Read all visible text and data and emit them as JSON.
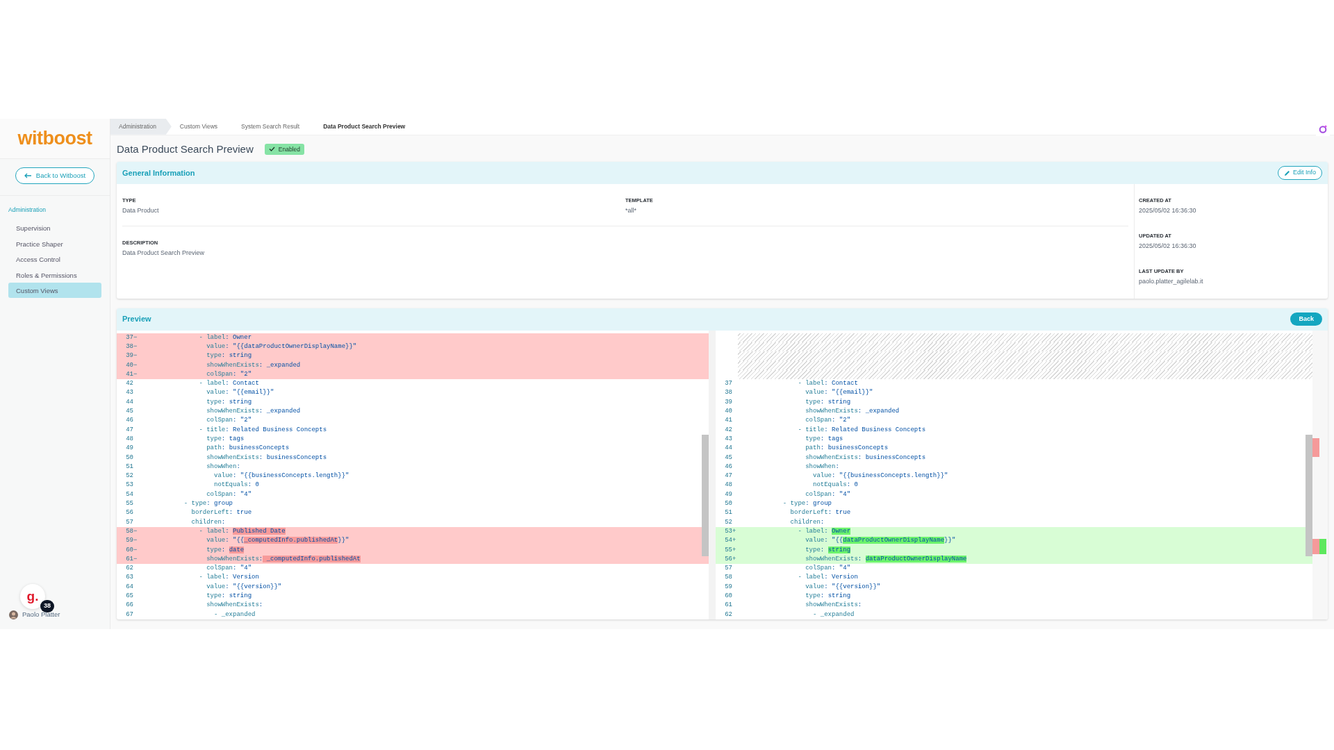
{
  "logo": "witboost",
  "back_link": "Back to Witboost",
  "sidebar": {
    "section": "Administration",
    "items": [
      {
        "label": "Supervision",
        "selected": false
      },
      {
        "label": "Practice Shaper",
        "selected": false
      },
      {
        "label": "Access Control",
        "selected": false
      },
      {
        "label": "Roles & Permissions",
        "selected": false
      },
      {
        "label": "Custom Views",
        "selected": true
      }
    ]
  },
  "assistant": {
    "glyph": "g.",
    "count": "38"
  },
  "user": {
    "name": "Paolo Platter"
  },
  "breadcrumbs": [
    {
      "label": "Administration",
      "hovered": true,
      "selected": false
    },
    {
      "label": "Custom Views",
      "hovered": false,
      "selected": false
    },
    {
      "label": "System Search Result",
      "hovered": false,
      "selected": false
    },
    {
      "label": "Data Product Search Preview",
      "hovered": false,
      "selected": true
    }
  ],
  "page": {
    "title": "Data Product Search Preview",
    "status": "Enabled"
  },
  "general_info": {
    "title": "General Information",
    "edit_button": "Edit Info",
    "rows": [
      [
        {
          "label": "TYPE",
          "value": "Data Product"
        },
        {
          "label": "TEMPLATE",
          "value": "*all*"
        }
      ],
      [
        {
          "label": "DESCRIPTION",
          "value": "Data Product Search Preview"
        }
      ]
    ],
    "meta": [
      {
        "label": "CREATED AT",
        "value": "2025/05/02 16:36:30"
      },
      {
        "label": "UPDATED AT",
        "value": "2025/05/02 16:36:30"
      },
      {
        "label": "LAST UPDATE BY",
        "value": "paolo.platter_agilelab.it"
      }
    ]
  },
  "preview": {
    "title": "Preview",
    "back_button": "Back",
    "left": [
      {
        "kind": "removed",
        "number": "37",
        "marker": "−",
        "text": "                - label: Owner"
      },
      {
        "kind": "removed",
        "number": "38",
        "marker": "−",
        "text": "                  value: \"{{dataProductOwnerDisplayName}}\""
      },
      {
        "kind": "removed",
        "number": "39",
        "marker": "−",
        "text": "                  type: string"
      },
      {
        "kind": "removed",
        "number": "40",
        "marker": "−",
        "text": "                  showWhenExists: _expanded"
      },
      {
        "kind": "removed",
        "number": "41",
        "marker": "−",
        "text": "                  colSpan: \"2\""
      },
      {
        "kind": "context",
        "number": "42",
        "text": "                - label: Contact"
      },
      {
        "kind": "context",
        "number": "43",
        "text": "                  value: \"{{email}}\""
      },
      {
        "kind": "context",
        "number": "44",
        "text": "                  type: string"
      },
      {
        "kind": "context",
        "number": "45",
        "text": "                  showWhenExists: _expanded"
      },
      {
        "kind": "context",
        "number": "46",
        "text": "                  colSpan: \"2\""
      },
      {
        "kind": "context",
        "number": "47",
        "text": "                - title: Related Business Concepts"
      },
      {
        "kind": "context",
        "number": "48",
        "text": "                  type: tags"
      },
      {
        "kind": "context",
        "number": "49",
        "text": "                  path: businessConcepts"
      },
      {
        "kind": "context",
        "number": "50",
        "text": "                  showWhenExists: businessConcepts"
      },
      {
        "kind": "context",
        "number": "51",
        "text": "                  showWhen:"
      },
      {
        "kind": "context",
        "number": "52",
        "text": "                    value: \"{{businessConcepts.length}}\""
      },
      {
        "kind": "context",
        "number": "53",
        "text": "                    notEquals: 0"
      },
      {
        "kind": "context",
        "number": "54",
        "text": "                  colSpan: \"4\""
      },
      {
        "kind": "context",
        "number": "55",
        "text": "            - type: group"
      },
      {
        "kind": "context",
        "number": "56",
        "text": "              borderLeft: true"
      },
      {
        "kind": "context",
        "number": "57",
        "text": "              children:"
      },
      {
        "kind": "removed",
        "number": "58",
        "marker": "−",
        "segments": [
          {
            "text": "                - label: ",
            "changed": false
          },
          {
            "text": "Published Date",
            "changed": true
          }
        ]
      },
      {
        "kind": "removed",
        "number": "59",
        "marker": "−",
        "segments": [
          {
            "text": "                  value: \"{{",
            "changed": false
          },
          {
            "text": "_computedInfo.publishedAt",
            "changed": true
          },
          {
            "text": "}}\"",
            "changed": false
          }
        ]
      },
      {
        "kind": "removed",
        "number": "60",
        "marker": "−",
        "segments": [
          {
            "text": "                  type: ",
            "changed": false
          },
          {
            "text": "date",
            "changed": true
          }
        ]
      },
      {
        "kind": "removed",
        "number": "61",
        "marker": "−",
        "segments": [
          {
            "text": "                  showWhenExists:",
            "changed": false
          },
          {
            "text": " _computedInfo.publishedAt",
            "changed": true
          }
        ]
      },
      {
        "kind": "context",
        "number": "62",
        "text": "                  colSpan: \"4\""
      },
      {
        "kind": "context",
        "number": "63",
        "text": "                - label: Version"
      },
      {
        "kind": "context",
        "number": "64",
        "text": "                  value: \"{{version}}\""
      },
      {
        "kind": "context",
        "number": "65",
        "text": "                  type: string"
      },
      {
        "kind": "context",
        "number": "66",
        "text": "                  showWhenExists:"
      },
      {
        "kind": "context",
        "number": "67",
        "text": "                    - _expanded"
      }
    ],
    "right": [
      {
        "kind": "filler"
      },
      {
        "kind": "filler"
      },
      {
        "kind": "filler"
      },
      {
        "kind": "filler"
      },
      {
        "kind": "filler"
      },
      {
        "kind": "context",
        "number": "37",
        "text": "                - label: Contact"
      },
      {
        "kind": "context",
        "number": "38",
        "text": "                  value: \"{{email}}\""
      },
      {
        "kind": "context",
        "number": "39",
        "text": "                  type: string"
      },
      {
        "kind": "context",
        "number": "40",
        "text": "                  showWhenExists: _expanded"
      },
      {
        "kind": "context",
        "number": "41",
        "text": "                  colSpan: \"2\""
      },
      {
        "kind": "context",
        "number": "42",
        "text": "                - title: Related Business Concepts"
      },
      {
        "kind": "context",
        "number": "43",
        "text": "                  type: tags"
      },
      {
        "kind": "context",
        "number": "44",
        "text": "                  path: businessConcepts"
      },
      {
        "kind": "context",
        "number": "45",
        "text": "                  showWhenExists: businessConcepts"
      },
      {
        "kind": "context",
        "number": "46",
        "text": "                  showWhen:"
      },
      {
        "kind": "context",
        "number": "47",
        "text": "                    value: \"{{businessConcepts.length}}\""
      },
      {
        "kind": "context",
        "number": "48",
        "text": "                    notEquals: 0"
      },
      {
        "kind": "context",
        "number": "49",
        "text": "                  colSpan: \"4\""
      },
      {
        "kind": "context",
        "number": "50",
        "text": "            - type: group"
      },
      {
        "kind": "context",
        "number": "51",
        "text": "              borderLeft: true"
      },
      {
        "kind": "context",
        "number": "52",
        "text": "              children:"
      },
      {
        "kind": "added",
        "number": "53",
        "marker": "+",
        "segments": [
          {
            "text": "                - label: ",
            "changed": false
          },
          {
            "text": "Owner",
            "changed": true
          }
        ]
      },
      {
        "kind": "added",
        "number": "54",
        "marker": "+",
        "segments": [
          {
            "text": "                  value: \"{{",
            "changed": false
          },
          {
            "text": "dataProductOwnerDisplayName",
            "changed": true
          },
          {
            "text": "}}\"",
            "changed": false
          }
        ]
      },
      {
        "kind": "added",
        "number": "55",
        "marker": "+",
        "segments": [
          {
            "text": "                  type: ",
            "changed": false
          },
          {
            "text": "string",
            "changed": true
          }
        ]
      },
      {
        "kind": "added",
        "number": "56",
        "marker": "+",
        "segments": [
          {
            "text": "                  showWhenExists: ",
            "changed": false
          },
          {
            "text": "dataProductOwnerDisplayName",
            "changed": true
          }
        ]
      },
      {
        "kind": "context",
        "number": "57",
        "text": "                  colSpan: \"4\""
      },
      {
        "kind": "context",
        "number": "58",
        "text": "                - label: Version"
      },
      {
        "kind": "context",
        "number": "59",
        "text": "                  value: \"{{version}}\""
      },
      {
        "kind": "context",
        "number": "60",
        "text": "                  type: string"
      },
      {
        "kind": "context",
        "number": "61",
        "text": "                  showWhenExists:"
      },
      {
        "kind": "context",
        "number": "62",
        "text": "                    - _expanded"
      }
    ]
  }
}
